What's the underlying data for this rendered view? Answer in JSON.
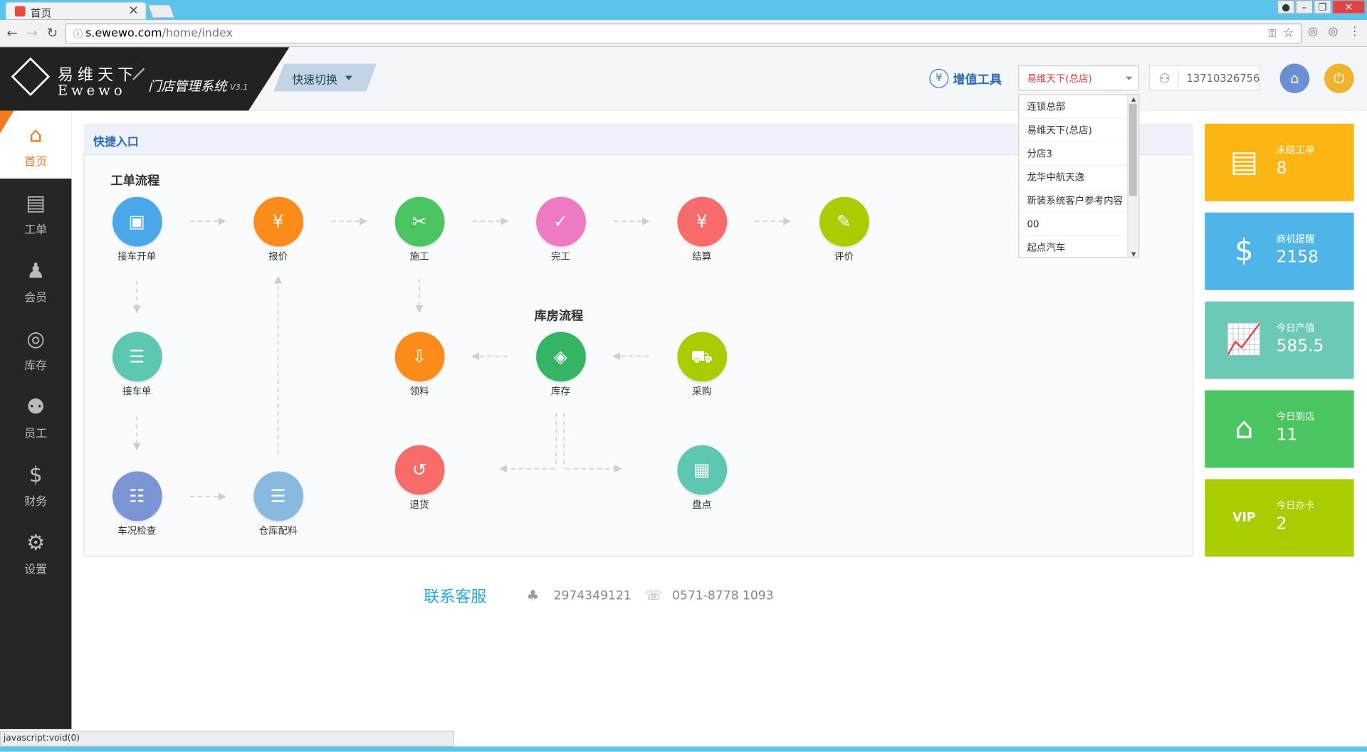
{
  "browser": {
    "tab_title": "首页",
    "url_host": "s.ewewo.com",
    "url_path": "/home/index",
    "status_text": "javascript:void(0)"
  },
  "header": {
    "logo_cn": "易维天下",
    "logo_en": "Ewewo",
    "system_name": "门店管理系统",
    "version": "V3.1",
    "quick_switch": "快速切换",
    "value_added_tools": "增值工具",
    "store_selected": "易维天下(总店)",
    "phone": "13710326756"
  },
  "store_dropdown": {
    "options": [
      "连锁总部",
      "易维天下(总店)",
      "分店3",
      "龙华中航天逸",
      "新装系统客户参考内容",
      "00",
      "起点汽车"
    ]
  },
  "sidebar": {
    "items": [
      {
        "label": "首页",
        "icon": "home-icon"
      },
      {
        "label": "工单",
        "icon": "workorder-icon"
      },
      {
        "label": "会员",
        "icon": "member-icon"
      },
      {
        "label": "库存",
        "icon": "inventory-icon"
      },
      {
        "label": "员工",
        "icon": "staff-icon"
      },
      {
        "label": "财务",
        "icon": "finance-icon"
      },
      {
        "label": "设置",
        "icon": "settings-icon"
      }
    ]
  },
  "quick_entry": {
    "title": "快捷入口",
    "workflow_title": "工单流程",
    "warehouse_title": "库房流程",
    "nodes": {
      "reception_open": "接车开单",
      "quote": "报价",
      "construction": "施工",
      "complete": "完工",
      "settle": "结算",
      "evaluate": "评价",
      "reception_sheet": "接车单",
      "vehicle_check": "车况检查",
      "warehouse_parts": "仓库配料",
      "pick_material": "领料",
      "inventory": "库存",
      "purchase": "采购",
      "return": "退货",
      "stocktake": "盘点"
    }
  },
  "stats": [
    {
      "label": "未结工单",
      "value": "8",
      "color": "#fbb614",
      "icon": "document-icon"
    },
    {
      "label": "商机提醒",
      "value": "2158",
      "color": "#4fb4e7",
      "icon": "money-bag-icon"
    },
    {
      "label": "今日产值",
      "value": "585.5",
      "color": "#6cc9b5",
      "icon": "growth-chart-icon"
    },
    {
      "label": "今日到店",
      "value": "11",
      "color": "#4bc462",
      "icon": "store-icon"
    },
    {
      "label": "今日办卡",
      "value": "2",
      "color": "#a8cd00",
      "icon": "vip-card-icon"
    }
  ],
  "contact": {
    "title": "联系客服",
    "qq": "2974349121",
    "phone": "0571-8778 1093"
  }
}
